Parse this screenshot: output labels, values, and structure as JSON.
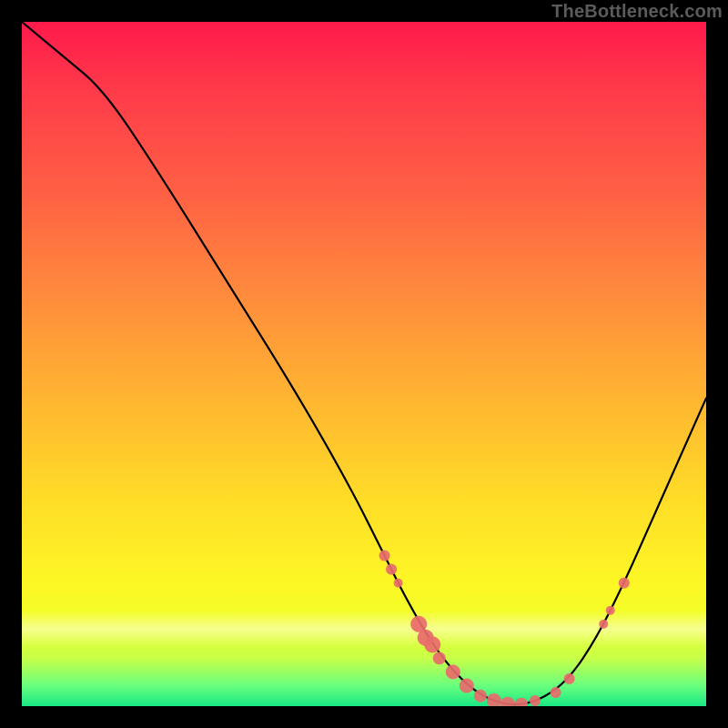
{
  "watermark": "TheBottleneck.com",
  "colors": {
    "curve_stroke": "#000000",
    "marker_fill": "#e86b6b",
    "marker_stroke": "#e86b6b"
  },
  "chart_data": {
    "type": "line",
    "title": "",
    "xlabel": "",
    "ylabel": "",
    "xlim": [
      0,
      100
    ],
    "ylim": [
      0,
      100
    ],
    "grid": false,
    "legend": false,
    "curve": [
      {
        "x": 0,
        "y": 100
      },
      {
        "x": 6,
        "y": 95
      },
      {
        "x": 12,
        "y": 90
      },
      {
        "x": 20,
        "y": 78
      },
      {
        "x": 30,
        "y": 62
      },
      {
        "x": 40,
        "y": 46
      },
      {
        "x": 48,
        "y": 32
      },
      {
        "x": 53,
        "y": 22
      },
      {
        "x": 56,
        "y": 16
      },
      {
        "x": 60,
        "y": 9
      },
      {
        "x": 64,
        "y": 4
      },
      {
        "x": 68,
        "y": 1
      },
      {
        "x": 72,
        "y": 0
      },
      {
        "x": 76,
        "y": 1
      },
      {
        "x": 80,
        "y": 4
      },
      {
        "x": 84,
        "y": 10
      },
      {
        "x": 88,
        "y": 18
      },
      {
        "x": 92,
        "y": 27
      },
      {
        "x": 96,
        "y": 36
      },
      {
        "x": 100,
        "y": 45
      }
    ],
    "markers": [
      {
        "x": 53,
        "y": 22,
        "size": 6
      },
      {
        "x": 54,
        "y": 20,
        "size": 6
      },
      {
        "x": 55,
        "y": 18,
        "size": 5
      },
      {
        "x": 58,
        "y": 12,
        "size": 9
      },
      {
        "x": 59,
        "y": 10,
        "size": 9
      },
      {
        "x": 60,
        "y": 9,
        "size": 9
      },
      {
        "x": 61,
        "y": 7,
        "size": 7
      },
      {
        "x": 63,
        "y": 5,
        "size": 8
      },
      {
        "x": 65,
        "y": 3,
        "size": 8
      },
      {
        "x": 67,
        "y": 1.5,
        "size": 7
      },
      {
        "x": 69,
        "y": 0.8,
        "size": 8
      },
      {
        "x": 71,
        "y": 0.3,
        "size": 8
      },
      {
        "x": 73,
        "y": 0.3,
        "size": 7
      },
      {
        "x": 75,
        "y": 0.8,
        "size": 6
      },
      {
        "x": 78,
        "y": 2,
        "size": 6
      },
      {
        "x": 80,
        "y": 4,
        "size": 6
      },
      {
        "x": 85,
        "y": 12,
        "size": 5
      },
      {
        "x": 86,
        "y": 14,
        "size": 5
      },
      {
        "x": 88,
        "y": 18,
        "size": 6
      }
    ]
  }
}
